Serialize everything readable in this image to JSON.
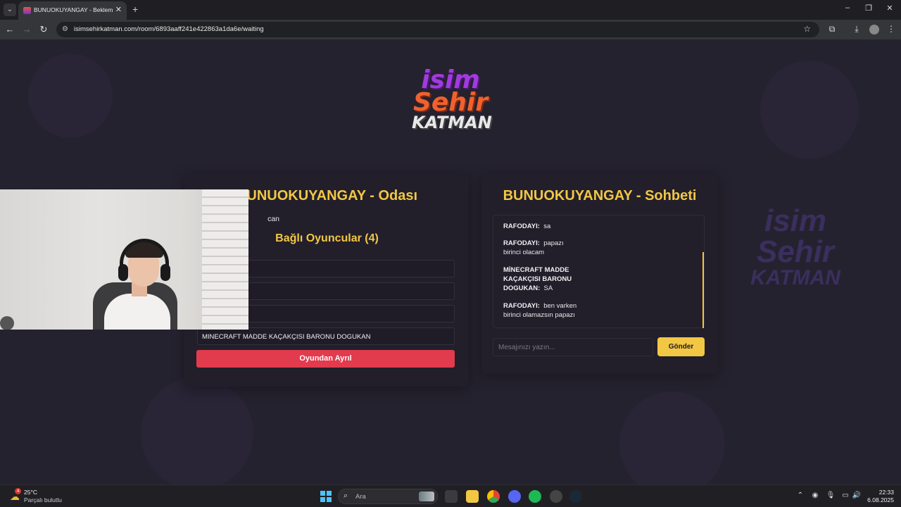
{
  "browser": {
    "tab_title": "BUNUOKUYANGAY - Bekleme Odası",
    "new_tab_symbol": "+",
    "url": "isimsehirkatman.com/room/6893aaff241e422863a1da6e/waiting"
  },
  "logo": {
    "line1": "isim",
    "line2": "Sehir",
    "line3": "KATMAN"
  },
  "room": {
    "title": "BUNUOKUYANGAY - Odası",
    "creator_fragment": "can",
    "players_heading": "Bağlı Oyuncular (4)",
    "players": [
      "",
      "",
      "",
      "MINECRAFT MADDE KAÇAKÇISI BARONU DOGUKAN"
    ],
    "leave_button": "Oyundan Ayrıl"
  },
  "chat": {
    "title": "BUNUOKUYANGAY - Sohbeti",
    "messages": [
      {
        "user": "RAFODAYI:",
        "text": "sa"
      },
      {
        "user": "RAFODAYI:",
        "text": "papazı birinci olacam"
      },
      {
        "user": "MİNECRAFT MADDE KAÇAKÇISI BARONU DOGUKAN:",
        "text": "SA"
      },
      {
        "user": "RAFODAYI:",
        "text": "ben varken birinci olamazsın papazı"
      }
    ],
    "input_placeholder": "Mesajınızı yazın...",
    "send_button": "Gönder"
  },
  "taskbar": {
    "weather_badge": "4",
    "temperature": "25°C",
    "condition": "Parçalı bulutlu",
    "search_label": "Ara",
    "time": "22:33",
    "date": "6.08.2025"
  },
  "colors": {
    "accent_yellow": "#f2c744",
    "leave_red": "#e23b4e",
    "page_bg": "#25222f"
  }
}
